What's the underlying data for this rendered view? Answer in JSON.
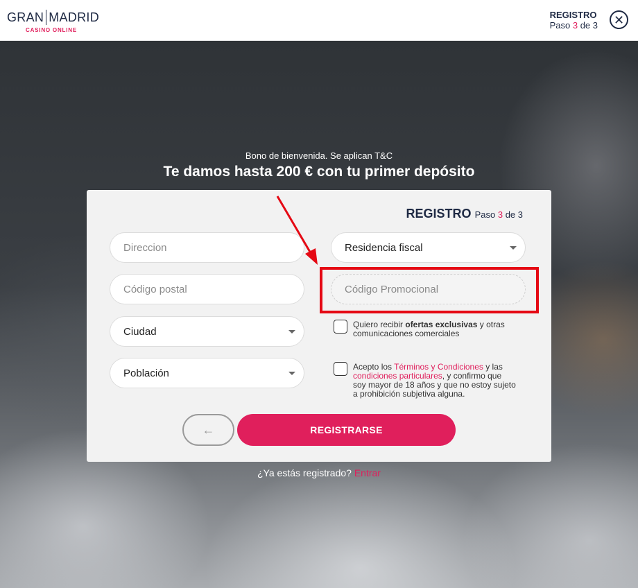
{
  "header": {
    "logo_main_left": "GRAN",
    "logo_main_right": "MADRID",
    "logo_sub": "CASINO ONLINE",
    "registration_title": "REGISTRO",
    "step_word": "Paso",
    "step_current": "3",
    "step_of": "de 3",
    "close_icon": "close-icon"
  },
  "promo": {
    "subtitle": "Bono de bienvenida. Se aplican T&C",
    "headline": "Te damos hasta 200 € con tu primer depósito"
  },
  "card": {
    "title": "REGISTRO",
    "step_word": "Paso",
    "step_current": "3",
    "step_of": "de 3"
  },
  "fields": {
    "address_placeholder": "Direccion",
    "postal_placeholder": "Código postal",
    "city_value": "Ciudad",
    "town_value": "Población",
    "tax_residence_value": "Residencia fiscal",
    "promo_code_placeholder": "Código Promocional"
  },
  "checkboxes": {
    "offers_prefix": "Quiero recibir ",
    "offers_bold": "ofertas exclusivas",
    "offers_suffix": " y otras comunicaciones comerciales",
    "terms_prefix": "Acepto los ",
    "terms_link1": "Términos y Condiciones",
    "terms_mid": " y las ",
    "terms_link2": "condiciones particulares",
    "terms_suffix": ", y confirmo que soy mayor de 18 años y que no estoy sujeto a prohibición subjetiva alguna."
  },
  "buttons": {
    "back_icon": "←",
    "submit_label": "REGISTRARSE"
  },
  "footer": {
    "login_prompt": "¿Ya estás registrado? ",
    "login_link": "Entrar"
  },
  "colors": {
    "accent": "#e01f5c",
    "highlight": "#e50914",
    "brand_dark": "#1f2a44"
  }
}
